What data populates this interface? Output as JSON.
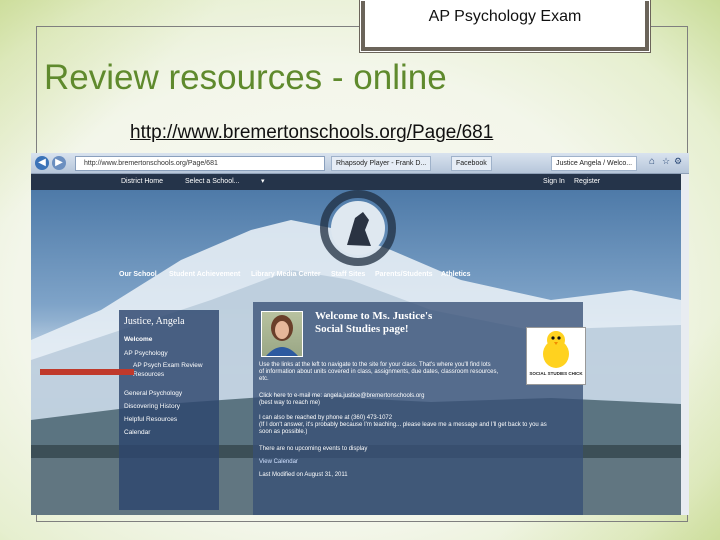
{
  "slide": {
    "tab_title": "AP Psychology Exam",
    "title": "Review resources - online",
    "url": "http://www.bremertonschools.org/Page/681"
  },
  "colors": {
    "title_green": "#5f8a2d",
    "tab_brown": "#6b645a",
    "panel_blue": "#2d466e"
  },
  "browser": {
    "address": "http://www.bremertonschools.org/Page/681",
    "tabs": [
      "Rhapsody Player - Frank D...",
      "Facebook",
      "Justice Angela / Welco..."
    ],
    "sitebar": {
      "home": "District Home",
      "select": "Select a School...",
      "sign_in": "Sign In",
      "register": "Register"
    }
  },
  "site": {
    "menu": [
      "Our School",
      "Student Achievement",
      "Library Media Center",
      "Staff Sites",
      "Parents/Students",
      "Athletics"
    ],
    "left_title": "Justice, Angela",
    "left_items": [
      "Welcome",
      "AP Psychology",
      "AP Psych Exam Review",
      "Resources",
      "General Psychology",
      "Discovering History",
      "Helpful Resources",
      "Calendar"
    ],
    "welcome_line1": "Welcome to Ms. Justice's",
    "welcome_line2": "Social Studies page!",
    "body": [
      "Use the links at the left to navigate to the site for your class. That's where you'll find lots",
      "of information about units covered in class, assignments, due dates, classroom resources,",
      "etc.",
      "Click here to e-mail me: angela.justice@bremertonschools.org",
      "(best way to reach me)",
      "I can also be reached by phone at (360) 473-1072",
      "(If I don't answer, it's probably because I'm teaching... please leave me a message and I'll get back to you as",
      "soon as possible.)",
      "There are no upcoming events to display",
      "View Calendar",
      "Last Modified on August 31, 2011"
    ],
    "chick_caption": "SOCIAL STUDIES CHICK"
  }
}
